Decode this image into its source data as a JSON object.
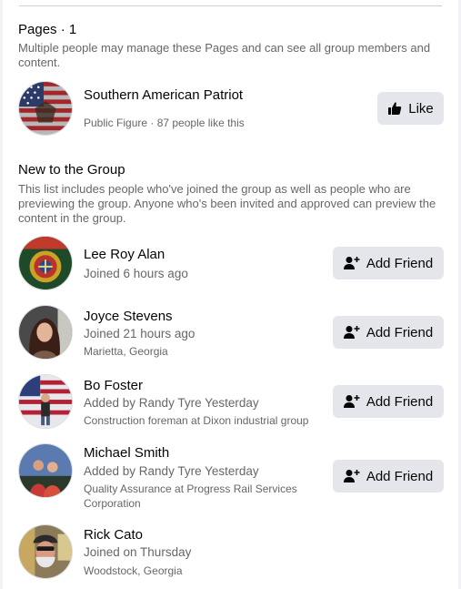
{
  "pages_section": {
    "title": "Pages · 1",
    "description": "Multiple people may manage these Pages and can see all group members and content.",
    "page": {
      "name": "Southern American Patriot",
      "meta": "Public Figure · 87 people like this",
      "button_label": "Like",
      "button_icon": "thumbs-up-icon"
    }
  },
  "new_section": {
    "title": "New to the Group",
    "description": "This list includes people who've joined the group as well as people who are previewing the group. Anyone who's been invited and approved can preview the content in the group."
  },
  "members": [
    {
      "name": "Lee Roy Alan",
      "status": "Joined 6 hours ago",
      "meta": "",
      "button_label": "Add Friend"
    },
    {
      "name": "Joyce Stevens",
      "status": "Joined 21 hours ago",
      "meta": "Marietta, Georgia",
      "button_label": "Add Friend"
    },
    {
      "name": "Bo Foster",
      "status": "Added by Randy Tyre Yesterday",
      "meta": "Construction foreman at Dixon industrial group",
      "button_label": "Add Friend"
    },
    {
      "name": "Michael Smith",
      "status": "Added by Randy Tyre Yesterday",
      "meta": "Quality Assurance at Progress Rail Services Corporation",
      "button_label": "Add Friend"
    },
    {
      "name": "Rick Cato",
      "status": "Joined on Thursday",
      "meta": "Woodstock, Georgia",
      "button_label": ""
    }
  ],
  "icons": {
    "add_friend": "add-friend-icon",
    "like": "thumbs-up-icon"
  },
  "colors": {
    "button_bg": "#e4e6eb",
    "secondary_text": "#65676b",
    "primary_text": "#050505"
  }
}
